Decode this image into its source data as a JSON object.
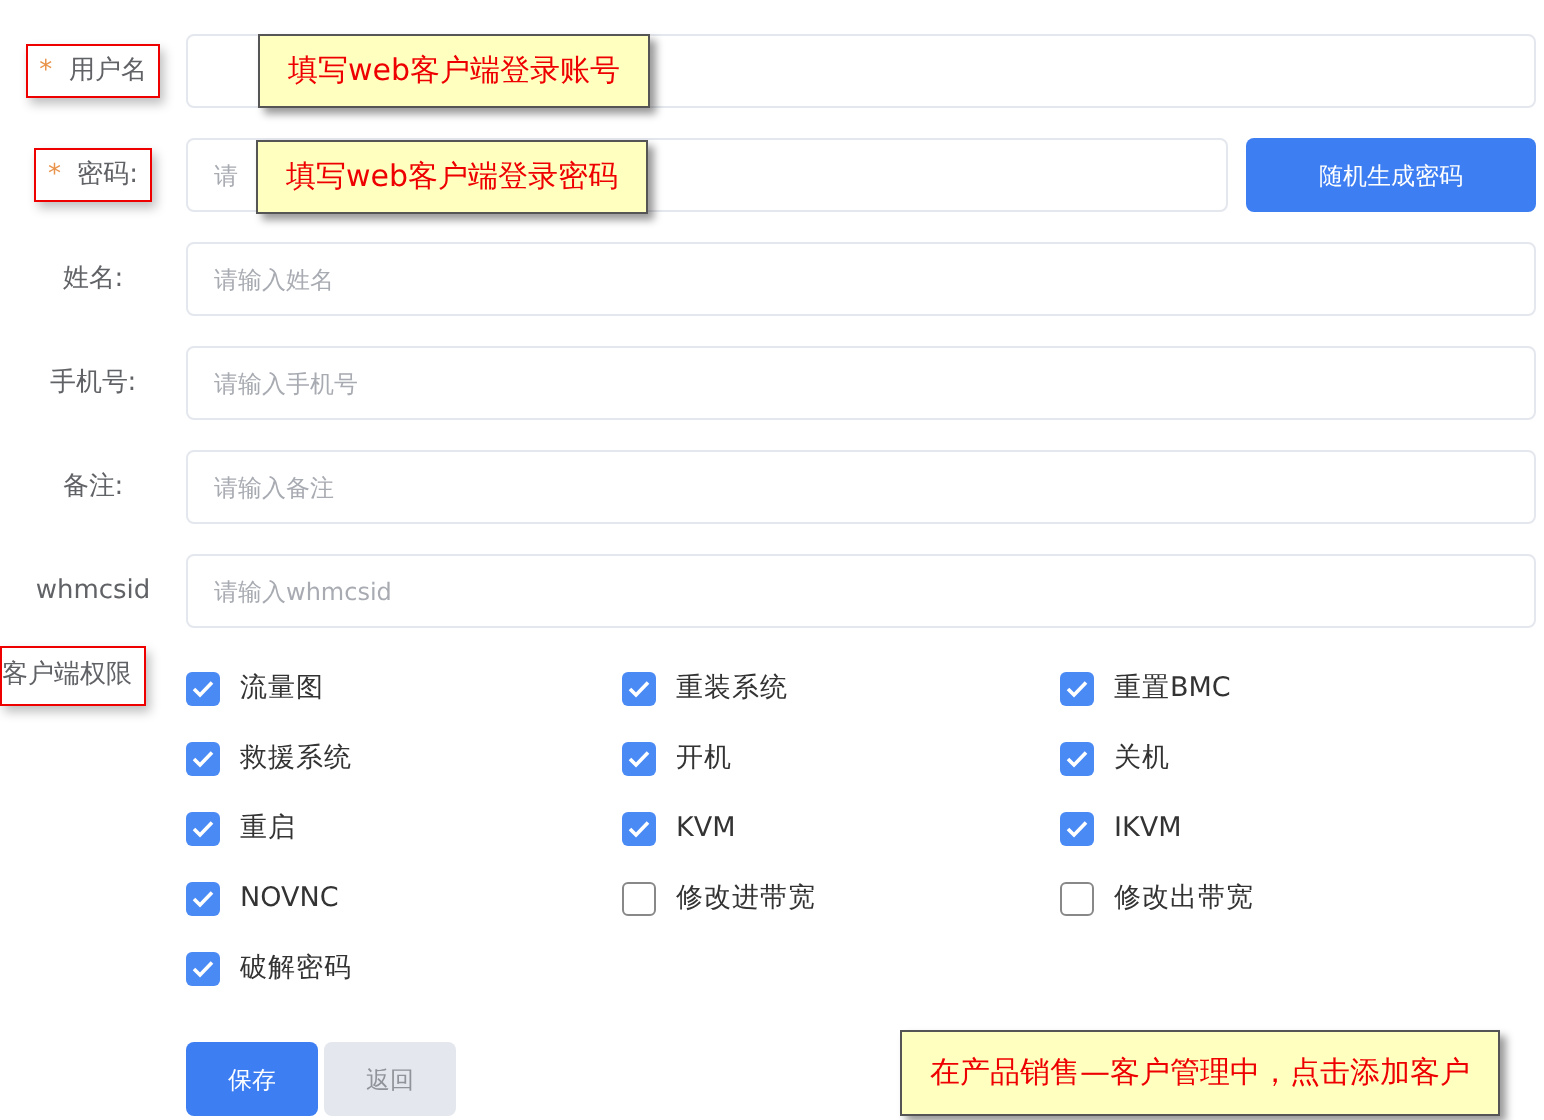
{
  "fields": [
    {
      "label": "用户名",
      "required_mark": "*",
      "highlighted": true,
      "note": "填写web客户端登录账号",
      "kind": "input"
    },
    {
      "label": "密码:",
      "required_mark": "*",
      "highlighted": true,
      "placeholder": "请",
      "note": "填写web客户端登录密码",
      "kind": "input-with-button",
      "button": "随机生成密码"
    },
    {
      "label": "姓名:",
      "highlighted": false,
      "placeholder": "请输入姓名",
      "kind": "input"
    },
    {
      "label": "手机号:",
      "highlighted": false,
      "placeholder": "请输入手机号",
      "kind": "input"
    },
    {
      "label": "备注:",
      "highlighted": false,
      "placeholder": "请输入备注",
      "kind": "input"
    },
    {
      "label": "whmcsid",
      "highlighted": false,
      "placeholder": "请输入whmcsid",
      "kind": "input"
    }
  ],
  "permissions": {
    "label": "客户端权限",
    "highlighted": true,
    "options": [
      {
        "label": "流量图",
        "checked": true
      },
      {
        "label": "重装系统",
        "checked": true
      },
      {
        "label": "重置BMC",
        "checked": true
      },
      {
        "label": "救援系统",
        "checked": true
      },
      {
        "label": "开机",
        "checked": true
      },
      {
        "label": "关机",
        "checked": true
      },
      {
        "label": "重启",
        "checked": true
      },
      {
        "label": "KVM",
        "checked": true
      },
      {
        "label": "IKVM",
        "checked": true
      },
      {
        "label": "NOVNC",
        "checked": true
      },
      {
        "label": "修改进带宽",
        "checked": false
      },
      {
        "label": "修改出带宽",
        "checked": false
      },
      {
        "label": "破解密码",
        "checked": true
      }
    ]
  },
  "actions": [
    {
      "label": "保存",
      "kind": "primary"
    },
    {
      "label": "返回",
      "kind": "secondary"
    }
  ],
  "footer_note": "在产品销售—客户管理中，点击添加客户"
}
